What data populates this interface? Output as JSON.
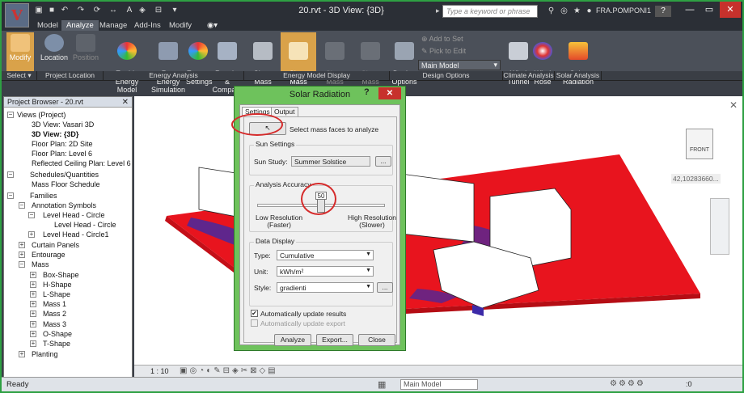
{
  "titlebar": {
    "title": "20.rvt - 3D View: {3D}",
    "search_placeholder": "Type a keyword or phrase",
    "user": "FRA.POMPONI1",
    "help": "?"
  },
  "tabs": [
    "Model",
    "Analyze",
    "Manage",
    "Add-Ins",
    "Modify"
  ],
  "ribbon": {
    "buttons": {
      "modify": "Modify",
      "location": "Location",
      "position": "Position",
      "enable_energy": "Enable Energy\nModel",
      "run_energy": "Run Energy\nSimulation",
      "energy_settings": "Energy\nSettings",
      "results_compare": "Results &\nCompare",
      "show_mass_view": "Show Mass\nBy View",
      "show_mass_form": "Show Mass\nForm",
      "show_mass_surfaces": "Show Mass\nSurfaces",
      "show_mass_zones": "Show Mass\nZones",
      "design_options": "Design\nOptions",
      "add_to_set": "Add to Set",
      "pick_to_edit": "Pick to Edit",
      "main_model": "Main Model",
      "wind_tunnel": "Wind\nTunnel",
      "wind_rose": "Wind\nRose",
      "solar_radiation": "Solar\nRadiation"
    },
    "panels": [
      "Select ▾",
      "Project Location",
      "Energy Analysis",
      "Energy Model Display",
      "Design Options",
      "Climate Analysis",
      "Solar Analysis"
    ]
  },
  "project_browser": {
    "title": "Project Browser - 20.rvt",
    "items": [
      "Views (Project)",
      "3D View: Vasari 3D",
      "3D View: {3D}",
      "Floor Plan: 2D Site",
      "Floor Plan: Level 6",
      "Reflected Ceiling Plan: Level 6",
      "Schedules/Quantities",
      "Mass Floor Schedule",
      "Families",
      "Annotation Symbols",
      "Level Head - Circle",
      "Level Head - Circle",
      "Level Head - Circle1",
      "Curtain Panels",
      "Entourage",
      "Mass",
      "Box-Shape",
      "H-Shape",
      "L-Shape",
      "Mass 1",
      "Mass 2",
      "Mass 3",
      "O-Shape",
      "T-Shape",
      "Planting"
    ]
  },
  "viewport": {
    "coord": "42,10283660...",
    "viewcube_label": "FRONT",
    "scale": "1 : 10"
  },
  "dialog": {
    "title": "Solar Radiation",
    "tabs": [
      "Settings",
      "Output"
    ],
    "select_faces_text": "Select mass faces to analyze",
    "sun_settings_label": "Sun Settings",
    "sun_study_label": "Sun Study:",
    "sun_study_value": "Summer Solstice",
    "browse": "...",
    "accuracy_label": "Analysis Accuracy",
    "slider_value": "50",
    "slider_fraction": 0.5,
    "low_label": "Low Resolution\n(Faster)",
    "high_label": "High Resolution\n(Slower)",
    "data_display_label": "Data Display",
    "type_label": "Type:",
    "type_value": "Cumulative",
    "unit_label": "Unit:",
    "unit_value": "kWh/m²",
    "style_label": "Style:",
    "style_value": "gradienti",
    "auto_update_results": "Automatically update results",
    "auto_update_export": "Automatically update export",
    "auto_update_results_checked": true,
    "analyze": "Analyze",
    "export": "Export...",
    "close": "Close"
  },
  "statusbar": {
    "ready": "Ready",
    "model": "Main Model",
    "filter_count": ":0"
  },
  "colors": {
    "accent": "#d9a24a",
    "highlight_ring": "#d52a2a",
    "dialog_frame": "#6ec25c",
    "heat_red": "#e8141e",
    "heat_blue": "#3c2aa8"
  }
}
